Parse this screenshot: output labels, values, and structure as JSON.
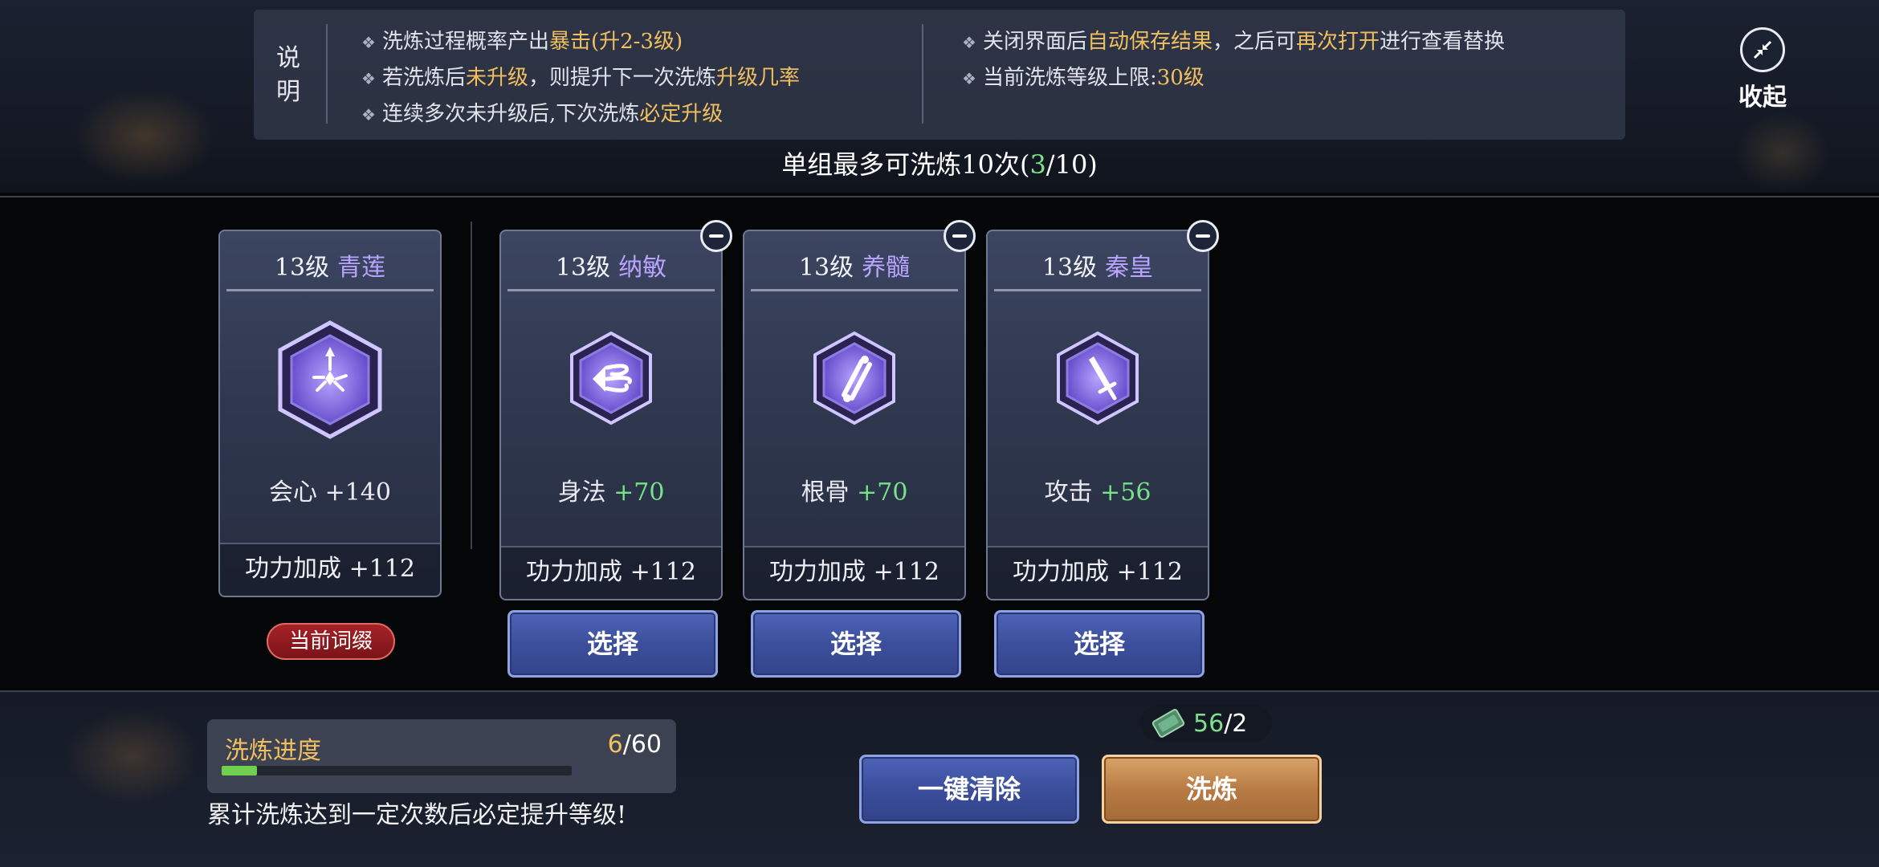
{
  "info": {
    "label": "说明",
    "left_lines": [
      {
        "pre": "洗炼过程概率产出",
        "hl": "暴击(升2-3级)",
        "post": ""
      },
      {
        "pre": "若洗炼后",
        "hl": "未升级",
        "post": "，则提升下一次洗炼",
        "hl2": "升级几率"
      },
      {
        "pre": "连续多次未升级后,下次洗炼",
        "hl": "必定升级",
        "post": ""
      }
    ],
    "right_lines": [
      {
        "pre": "关闭界面后",
        "hl": "自动保存结果",
        "post": "，之后可",
        "hl2": "再次打开",
        "post2": "进行查看替换"
      },
      {
        "pre": "当前洗炼等级上限:",
        "hl": "30级",
        "post": ""
      }
    ],
    "bullet": "❖"
  },
  "collapse": {
    "label": "收起",
    "icon": "collapse-arrows-icon"
  },
  "limit": {
    "pre": "单组最多可洗炼10次(",
    "current": "3",
    "post": "/10)"
  },
  "cards": [
    {
      "level": "13级",
      "name": "青莲",
      "icon": "burst-star-icon",
      "stat_name": "会心",
      "stat_value": "+140",
      "bonus": "功力加成 +112"
    },
    {
      "level": "13级",
      "name": "纳敏",
      "icon": "speed-wind-icon",
      "stat_name": "身法",
      "stat_value": "+70",
      "bonus": "功力加成 +112"
    },
    {
      "level": "13级",
      "name": "养髓",
      "icon": "bone-icon",
      "stat_name": "根骨",
      "stat_value": "+70",
      "bonus": "功力加成 +112"
    },
    {
      "level": "13级",
      "name": "秦皇",
      "icon": "sword-icon",
      "stat_name": "攻击",
      "stat_value": "+56",
      "bonus": "功力加成 +112"
    }
  ],
  "current_badge": "当前词缀",
  "select_label": "选择",
  "progress": {
    "label": "洗炼进度",
    "current": "6",
    "total": "/60",
    "fraction": 0.1,
    "note": "累计洗炼达到一定次数后必定提升等级!"
  },
  "currency": {
    "icon": "jade-token-icon",
    "owned": "56",
    "cost": "/2"
  },
  "buttons": {
    "clear": "一键清除",
    "refine": "洗炼"
  },
  "colors": {
    "highlight": "#f0c060",
    "positive": "#78e28a",
    "affix_name": "#b9a4ff",
    "badge": "#a62228"
  }
}
